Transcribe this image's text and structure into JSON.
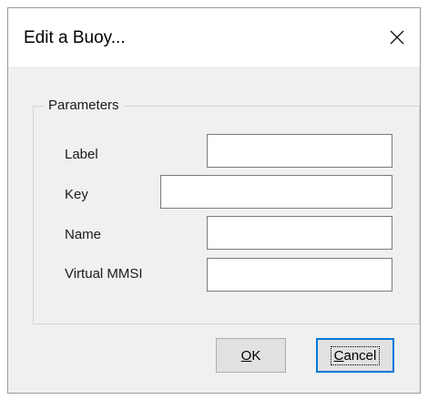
{
  "dialog": {
    "title": "Edit a Buoy...",
    "close_glyph": "✕"
  },
  "parameters": {
    "group_label": "Parameters",
    "fields": [
      {
        "label": "Label",
        "value": ""
      },
      {
        "label": "Key",
        "value": ""
      },
      {
        "label": "Name",
        "value": ""
      },
      {
        "label": "Virtual MMSI",
        "value": ""
      }
    ]
  },
  "buttons": {
    "ok": {
      "mnemonic": "O",
      "rest": "K"
    },
    "cancel": {
      "mnemonic": "C",
      "rest": "ancel"
    }
  },
  "icons": {
    "close": "close-icon"
  }
}
